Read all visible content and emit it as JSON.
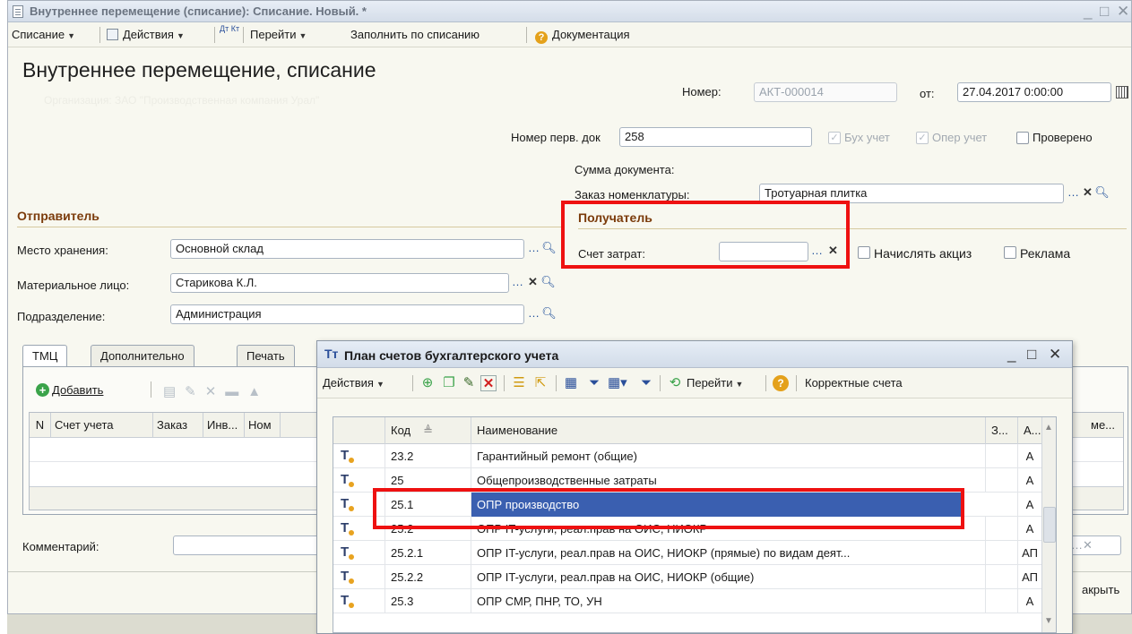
{
  "window": {
    "title": "Внутреннее перемещение (списание): Списание. Новый. *",
    "minimize": "_",
    "maximize": "□",
    "close": "✕"
  },
  "toolbar": {
    "spisanie": "Списание",
    "actions": "Действия",
    "dt_kt": "Дт Кт",
    "goto": "Перейти",
    "fill": "Заполнить по списанию",
    "docs": "Документация"
  },
  "form": {
    "title": "Внутреннее перемещение, списание",
    "subtitle": "Организация: ЗАО \"Производственная компания Урал\"",
    "number_label": "Номер:",
    "number_value": "АКТ-000014",
    "from_label": "от:",
    "date_value": "27.04.2017 0:00:00",
    "primary_doc_label": "Номер перв. док",
    "primary_doc_value": "258",
    "bux_label": "Бух учет",
    "oper_label": "Опер учет",
    "checked_label": "Проверено",
    "sum_label": "Сумма документа:",
    "order_label": "Заказ номенклатуры:",
    "order_value": "Тротуарная плитка"
  },
  "sender": {
    "heading": "Отправитель",
    "storage_label": "Место хранения:",
    "storage_value": "Основной склад",
    "person_label": "Материальное лицо:",
    "person_value": "Старикова К.Л.",
    "division_label": "Подразделение:",
    "division_value": "Администрация"
  },
  "receiver": {
    "heading": "Получатель",
    "cost_account_label": "Счет затрат:",
    "cost_account_value": "",
    "excise_label": "Начислять акциз",
    "advert_label": "Реклама"
  },
  "tabs": [
    {
      "label": "ТМЦ"
    },
    {
      "label": "Дополнительно"
    },
    {
      "label": "Печать"
    }
  ],
  "tmc": {
    "add": "Добавить",
    "columns": [
      "N",
      "Счет учета",
      "Заказ",
      "Инв...",
      "Ном",
      "ме..."
    ]
  },
  "bottom": {
    "comment_label": "Комментарий:",
    "comment_value": "",
    "close_label": "акрыть"
  },
  "popup": {
    "title": "План счетов бухгалтерского учета",
    "actions": "Действия",
    "goto": "Перейти",
    "help": "?",
    "correct_accounts": "Корректные счета",
    "headers": {
      "code": "Код",
      "name": "Наименование",
      "z": "З...",
      "a": "А..."
    },
    "rows": [
      {
        "code": "23.2",
        "name": "Гарантийный ремонт (общие)",
        "a": "А"
      },
      {
        "code": "25",
        "name": "Общепроизводственные затраты",
        "a": "А"
      },
      {
        "code": "25.1",
        "name": "ОПР производство",
        "a": "А"
      },
      {
        "code": "25.2",
        "name": "ОПР IT-услуги, реал.прав на ОИС, НИОКР",
        "a": "А"
      },
      {
        "code": "25.2.1",
        "name": "ОПР IT-услуги, реал.прав на ОИС, НИОКР (прямые) по видам деят...",
        "a": "АП"
      },
      {
        "code": "25.2.2",
        "name": "ОПР IT-услуги, реал.прав на ОИС, НИОКР (общие)",
        "a": "АП"
      },
      {
        "code": "25.3",
        "name": "ОПР СМР, ПНР, ТО, УН",
        "a": "А"
      }
    ]
  },
  "icons": [
    "doc-icon",
    "calendar-icon",
    "plus-icon",
    "refresh-icon",
    "help-icon",
    "funnel-icon",
    "pencil-icon",
    "delete-icon"
  ],
  "colors": {
    "highlight": "#ee1111",
    "selection": "#3a5fb0",
    "section": "#7b3b0b"
  }
}
